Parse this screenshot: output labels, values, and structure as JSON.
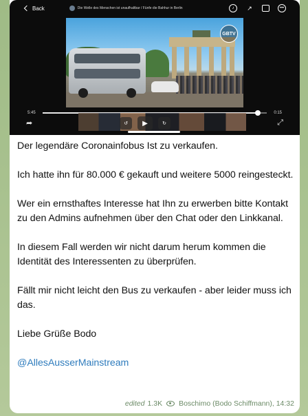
{
  "video": {
    "back_label": "Back",
    "title": "Die Welle des Menschen ist unaufhaltbar / Fünfe die Bahhur in Berlin",
    "channel_logo": "GBTV",
    "time_current": "5:45",
    "time_total": "0:15",
    "progress_fraction": 0.96,
    "icons": [
      "chevron-left-icon",
      "speaker-icon",
      "share-icon",
      "pip-icon",
      "more-icon",
      "play-icon",
      "rewind-15-icon",
      "forward-15-icon",
      "fullscreen-icon"
    ]
  },
  "message": {
    "paragraphs": [
      "Der legendäre Coronainfobus Ist zu verkaufen.",
      "Ich hatte ihn für 80.000 € gekauft und weitere 5000 reingesteckt.",
      "Wer ein ernsthaftes Interesse hat Ihn zu erwerben bitte Kontakt zu den Admins aufnehmen über den Chat oder den Linkkanal.",
      "In diesem Fall werden wir nicht darum herum kommen die Identität des Interessenten zu überprüfen.",
      "Fällt mir nicht leicht den Bus zu verkaufen - aber leider muss ich das.",
      "Liebe Grüße Bodo"
    ],
    "link": "@AllesAusserMainstream",
    "edited_label": "edited",
    "views": "1.3K",
    "author": "Boschimo (Bodo Schiffmann), 14:32"
  },
  "colors": {
    "background": "#a9c290",
    "link": "#2f7cbd",
    "meta": "#6b8a66"
  }
}
